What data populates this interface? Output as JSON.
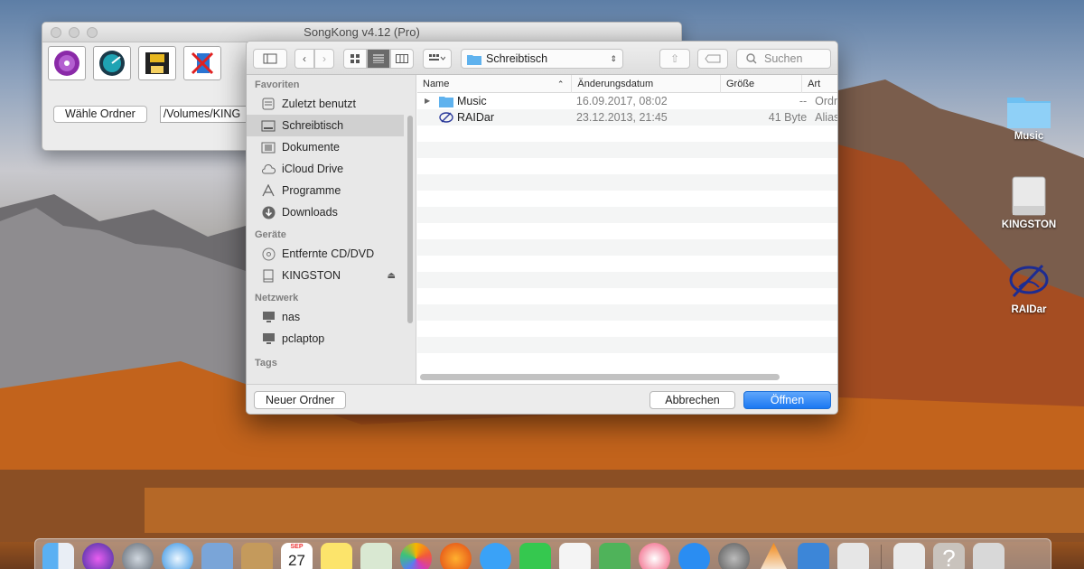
{
  "songkong": {
    "title": "SongKong v4.12 (Pro)",
    "choose_folder": "Wähle Ordner",
    "path_value": "/Volumes/KING"
  },
  "dialog": {
    "location": "Schreibtisch",
    "search_placeholder": "Suchen",
    "sidebar": {
      "favorites_label": "Favoriten",
      "favorites": [
        "Zuletzt benutzt",
        "Schreibtisch",
        "Dokumente",
        "iCloud Drive",
        "Programme",
        "Downloads"
      ],
      "devices_label": "Geräte",
      "devices": [
        "Entfernte CD/DVD",
        "KINGSTON"
      ],
      "network_label": "Netzwerk",
      "network": [
        "nas",
        "pclaptop"
      ],
      "tags_label": "Tags"
    },
    "columns": {
      "name": "Name",
      "date": "Änderungsdatum",
      "size": "Größe",
      "kind": "Art"
    },
    "files": [
      {
        "name": "Music",
        "date": "16.09.2017, 08:02",
        "size": "--",
        "kind": "Ordner"
      },
      {
        "name": "RAIDar",
        "date": "23.12.2013, 21:45",
        "size": "41 Byte",
        "kind": "Alias"
      }
    ],
    "new_folder": "Neuer Ordner",
    "cancel": "Abbrechen",
    "open": "Öffnen"
  },
  "desktop": {
    "icons": [
      "Music",
      "KINGSTON",
      "RAIDar"
    ]
  },
  "dock": {
    "calendar_month": "SEP",
    "calendar_day": "27"
  },
  "colors": {
    "accent": "#1b78f2",
    "folder": "#5fb2ee"
  }
}
